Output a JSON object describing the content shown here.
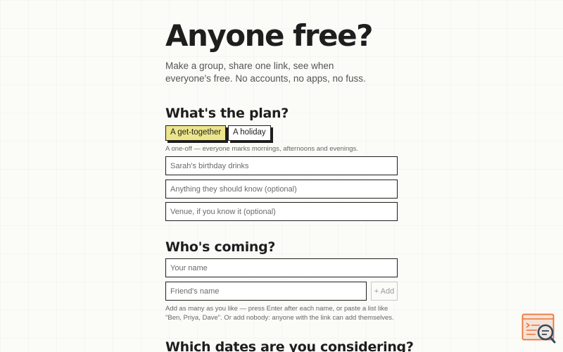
{
  "header": {
    "title": "Anyone free?",
    "subtitle": "Make a group, share one link, see when everyone's free. No accounts, no apps, no fuss."
  },
  "plan": {
    "heading": "What's the plan?",
    "options": [
      {
        "label": "A get-together",
        "selected": true
      },
      {
        "label": "A holiday",
        "selected": false
      }
    ],
    "hint": "A one-off — everyone marks mornings, afternoons and evenings.",
    "name_placeholder": "Sarah's birthday drinks",
    "notes_placeholder": "Anything they should know (optional)",
    "venue_placeholder": "Venue, if you know it (optional)"
  },
  "coming": {
    "heading": "Who's coming?",
    "your_name_placeholder": "Your name",
    "friend_placeholder": "Friend's name",
    "add_label": "+ Add",
    "hint": "Add as many as you like — press Enter after each name, or paste a list like \"Ben, Priya, Dave\". Or add nobody: anyone with the link can add themselves."
  },
  "dates": {
    "heading": "Which dates are you considering?"
  },
  "colors": {
    "accent": "#ece58a",
    "ink": "#1e1e1e",
    "widget_bg": "#f6e2d6",
    "widget_border": "#e8743b",
    "widget_lens": "#2e4b63"
  },
  "widget": {
    "icon": "feedback-search-icon"
  }
}
